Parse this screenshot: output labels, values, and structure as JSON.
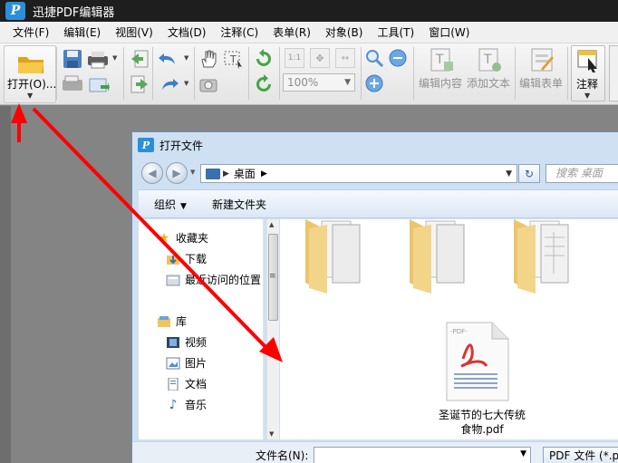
{
  "app": {
    "title": "迅捷PDF编辑器",
    "logo_letter": "P"
  },
  "menu": [
    "文件(F)",
    "编辑(E)",
    "视图(V)",
    "文档(D)",
    "注释(C)",
    "表单(R)",
    "对象(B)",
    "工具(T)",
    "窗口(W)"
  ],
  "toolbar": {
    "open_label": "打开(O)...",
    "zoom_value": "100%",
    "edit_content_label": "编辑内容",
    "add_text_label": "添加文本",
    "edit_form_label": "编辑表单",
    "comment_label": "注释",
    "zoom_one_to_one": "1:1"
  },
  "dialog": {
    "title": "打开文件",
    "logo_letter": "P",
    "address_path": "桌面",
    "search_placeholder": "搜索 桌面",
    "organize_label": "组织",
    "new_folder_label": "新建文件夹",
    "nav_items": [
      {
        "label": "收藏夹",
        "icon": "star-icon"
      },
      {
        "label": "下载",
        "icon": "download-folder-icon"
      },
      {
        "label": "最近访问的位置",
        "icon": "recent-places-icon"
      },
      {
        "label": "库",
        "icon": "library-icon"
      },
      {
        "label": "视频",
        "icon": "video-icon"
      },
      {
        "label": "图片",
        "icon": "picture-icon"
      },
      {
        "label": "文档",
        "icon": "document-icon"
      },
      {
        "label": "音乐",
        "icon": "music-icon"
      }
    ],
    "files": [
      {
        "name": "圣诞节的七大传统",
        "name_line2": "食物.pdf",
        "badge": "PDF"
      }
    ],
    "filename_label": "文件名(N):",
    "filter_label": "PDF 文件 (*.pd"
  },
  "colors": {
    "annotation_arrow": "#ff0000",
    "workspace": "#848484",
    "dialog_frame": "#cfe0f2"
  }
}
